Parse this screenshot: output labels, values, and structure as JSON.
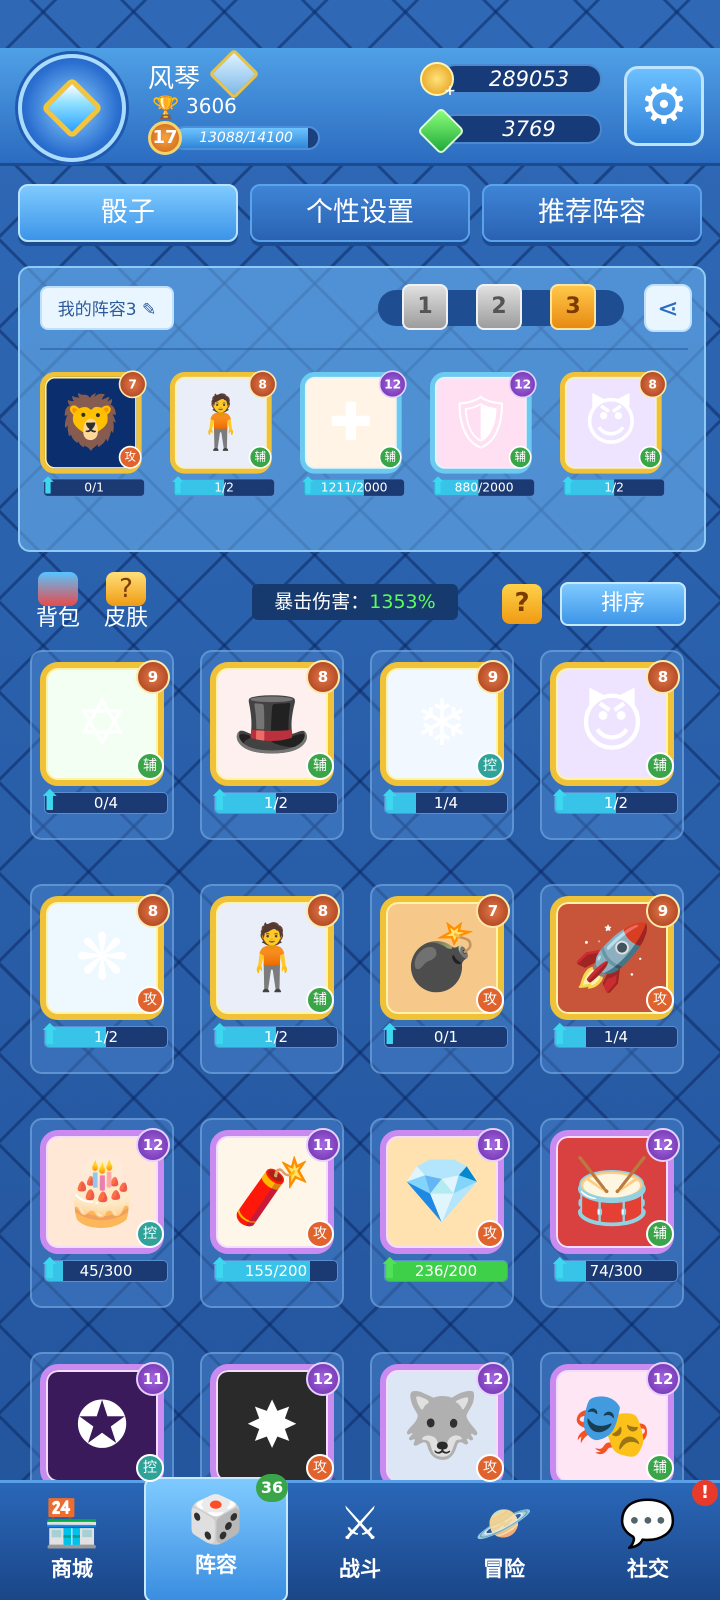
{
  "player": {
    "name": "风琴",
    "trophies": "3606",
    "level": "17",
    "xp": "13088/14100",
    "xp_fraction": 0.928
  },
  "currency": {
    "gold": "289053",
    "gems": "3769"
  },
  "tabs": [
    "骰子",
    "个性设置",
    "推荐阵容"
  ],
  "deck": {
    "label": "我的阵容3",
    "slots": [
      "1",
      "2",
      "3"
    ],
    "selected_slot": "3"
  },
  "deck_cards": [
    {
      "icon": "lion-icon",
      "level": "7",
      "role": "攻",
      "progress": "0/1",
      "fraction": 0.0,
      "frame": "gold"
    },
    {
      "icon": "body-icon",
      "level": "8",
      "role": "辅",
      "progress": "1/2",
      "fraction": 0.5,
      "frame": "gold"
    },
    {
      "icon": "cross-icon",
      "level": "12",
      "role": "辅",
      "progress": "1211/2000",
      "fraction": 0.6,
      "frame": "blue"
    },
    {
      "icon": "shield-icon",
      "level": "12",
      "role": "辅",
      "progress": "880/2000",
      "fraction": 0.44,
      "frame": "blue"
    },
    {
      "icon": "demon-icon",
      "level": "8",
      "role": "辅",
      "progress": "1/2",
      "fraction": 0.5,
      "frame": "gold"
    }
  ],
  "side": {
    "bag": "背包",
    "skin": "皮肤"
  },
  "crit": {
    "label": "暴击伤害：",
    "value": "1353%"
  },
  "sort_label": "排序",
  "collection": [
    {
      "icon": "hexagram-icon",
      "level": "9",
      "role": "辅",
      "progress": "0/4",
      "fraction": 0.0,
      "frame": "gold"
    },
    {
      "icon": "hat-icon",
      "level": "8",
      "role": "辅",
      "progress": "1/2",
      "fraction": 0.5,
      "frame": "gold"
    },
    {
      "icon": "snowflake-icon",
      "level": "9",
      "role": "控",
      "progress": "1/4",
      "fraction": 0.25,
      "frame": "gold"
    },
    {
      "icon": "demon-icon",
      "level": "8",
      "role": "辅",
      "progress": "1/2",
      "fraction": 0.5,
      "frame": "gold"
    },
    {
      "icon": "ice-spirit-icon",
      "level": "8",
      "role": "攻",
      "progress": "1/2",
      "fraction": 0.5,
      "frame": "gold"
    },
    {
      "icon": "body-icon",
      "level": "8",
      "role": "辅",
      "progress": "1/2",
      "fraction": 0.5,
      "frame": "gold"
    },
    {
      "icon": "grenade-icon",
      "level": "7",
      "role": "攻",
      "progress": "0/1",
      "fraction": 0.0,
      "frame": "gold"
    },
    {
      "icon": "rocket-icon",
      "level": "9",
      "role": "攻",
      "progress": "1/4",
      "fraction": 0.25,
      "frame": "gold"
    },
    {
      "icon": "cake-icon",
      "level": "12",
      "role": "控",
      "progress": "45/300",
      "fraction": 0.15,
      "frame": "purple"
    },
    {
      "icon": "firecracker-icon",
      "level": "11",
      "role": "攻",
      "progress": "155/200",
      "fraction": 0.775,
      "frame": "purple"
    },
    {
      "icon": "crystal-icon",
      "level": "11",
      "role": "攻",
      "progress": "236/200",
      "fraction": 1.0,
      "frame": "purple"
    },
    {
      "icon": "drum-icon",
      "level": "12",
      "role": "辅",
      "progress": "74/300",
      "fraction": 0.25,
      "frame": "purple"
    },
    {
      "icon": "sigil-icon",
      "level": "11",
      "role": "控",
      "progress": "",
      "fraction": 0.0,
      "frame": "purple"
    },
    {
      "icon": "rune-icon",
      "level": "12",
      "role": "攻",
      "progress": "",
      "fraction": 0.0,
      "frame": "purple"
    },
    {
      "icon": "wolf-icon",
      "level": "12",
      "role": "攻",
      "progress": "",
      "fraction": 0.0,
      "frame": "purple"
    },
    {
      "icon": "mask-icon",
      "level": "12",
      "role": "辅",
      "progress": "",
      "fraction": 0.0,
      "frame": "purple"
    }
  ],
  "nav": [
    {
      "icon": "shop-icon",
      "label": "商城"
    },
    {
      "icon": "dice-icon",
      "label": "阵容"
    },
    {
      "icon": "swords-icon",
      "label": "战斗"
    },
    {
      "icon": "planet-icon",
      "label": "冒险"
    },
    {
      "icon": "chat-icon",
      "label": "社交"
    }
  ],
  "nav_badge": "36",
  "alert_badge": "!"
}
